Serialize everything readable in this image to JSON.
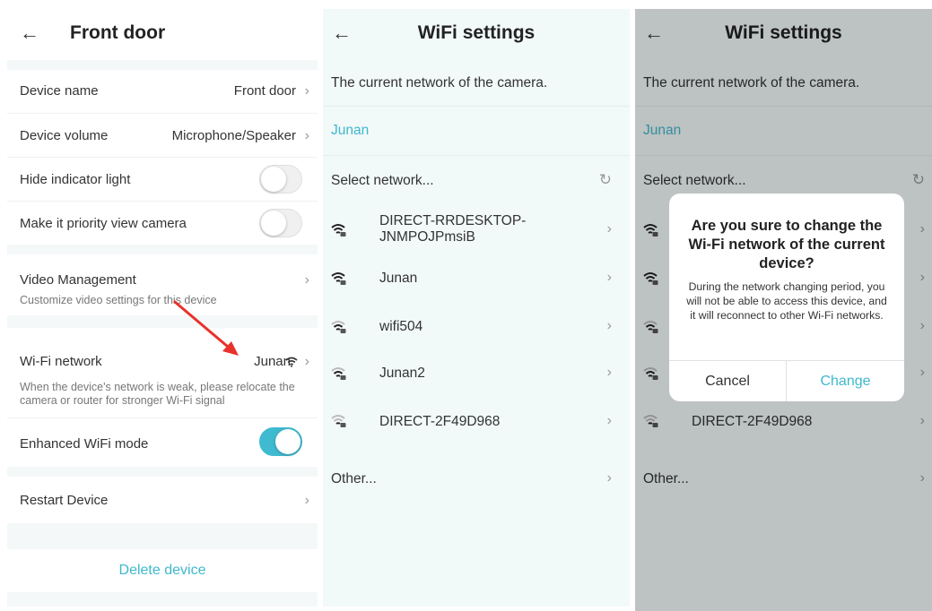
{
  "device_panel": {
    "title": "Front door",
    "rows": {
      "device_name": {
        "label": "Device name",
        "value": "Front door"
      },
      "device_volume": {
        "label": "Device volume",
        "value": "Microphone/Speaker"
      },
      "hide_indicator": {
        "label": "Hide indicator light",
        "enabled": false
      },
      "priority_view": {
        "label": "Make it priority view camera",
        "enabled": false
      },
      "video_management": {
        "label": "Video Management",
        "description": "Customize video settings for this device"
      },
      "wifi_network": {
        "label": "Wi-Fi network",
        "value": "Junan",
        "description": "When the device's network is weak, please relocate the camera or router for stronger Wi-Fi signal"
      },
      "enhanced_wifi": {
        "label": "Enhanced WiFi mode",
        "enabled": true
      },
      "restart": {
        "label": "Restart Device"
      }
    },
    "delete_label": "Delete device"
  },
  "wifi_panel": {
    "title": "WiFi settings",
    "current_network_caption": "The current network of the camera.",
    "current_network": "Junan",
    "select_label": "Select network...",
    "networks": [
      {
        "name": "DIRECT-RRDESKTOP-JNMPOJPmsiB",
        "line1": "DIRECT-RRDESKTOP-",
        "line2": "JNMPOJPmsiB",
        "signal": "strong",
        "locked": true
      },
      {
        "name": "Junan",
        "signal": "strong",
        "locked": true
      },
      {
        "name": "wifi504",
        "signal": "medium",
        "locked": true
      },
      {
        "name": "Junan2",
        "signal": "medium",
        "locked": true
      },
      {
        "name": "DIRECT-2F49D968",
        "signal": "weak",
        "locked": true
      }
    ],
    "other_label": "Other..."
  },
  "wifi_panel_dialog": {
    "title": "WiFi settings",
    "current_network_caption": "The current network of the camera.",
    "current_network": "Junan",
    "select_label": "Select network...",
    "visible_network": "DIRECT-2F49D968",
    "other_label": "Other...",
    "dialog": {
      "title": "Are you sure to change the Wi-Fi network of the current device?",
      "message": "During the network changing period, you will not be able to access this device, and it will reconnect to other Wi-Fi networks.",
      "cancel_label": "Cancel",
      "confirm_label": "Change"
    }
  },
  "colors": {
    "accent": "#3fb8cc",
    "annotation_arrow": "#e8322b",
    "panel_background": "#f2f9f9",
    "dim_overlay": "rgba(0,0,0,0.22)"
  },
  "icons": {
    "back": "arrow-left-icon",
    "chevron": "chevron-right-icon",
    "wifi": "wifi-lock-icon",
    "refresh": "refresh-icon"
  }
}
